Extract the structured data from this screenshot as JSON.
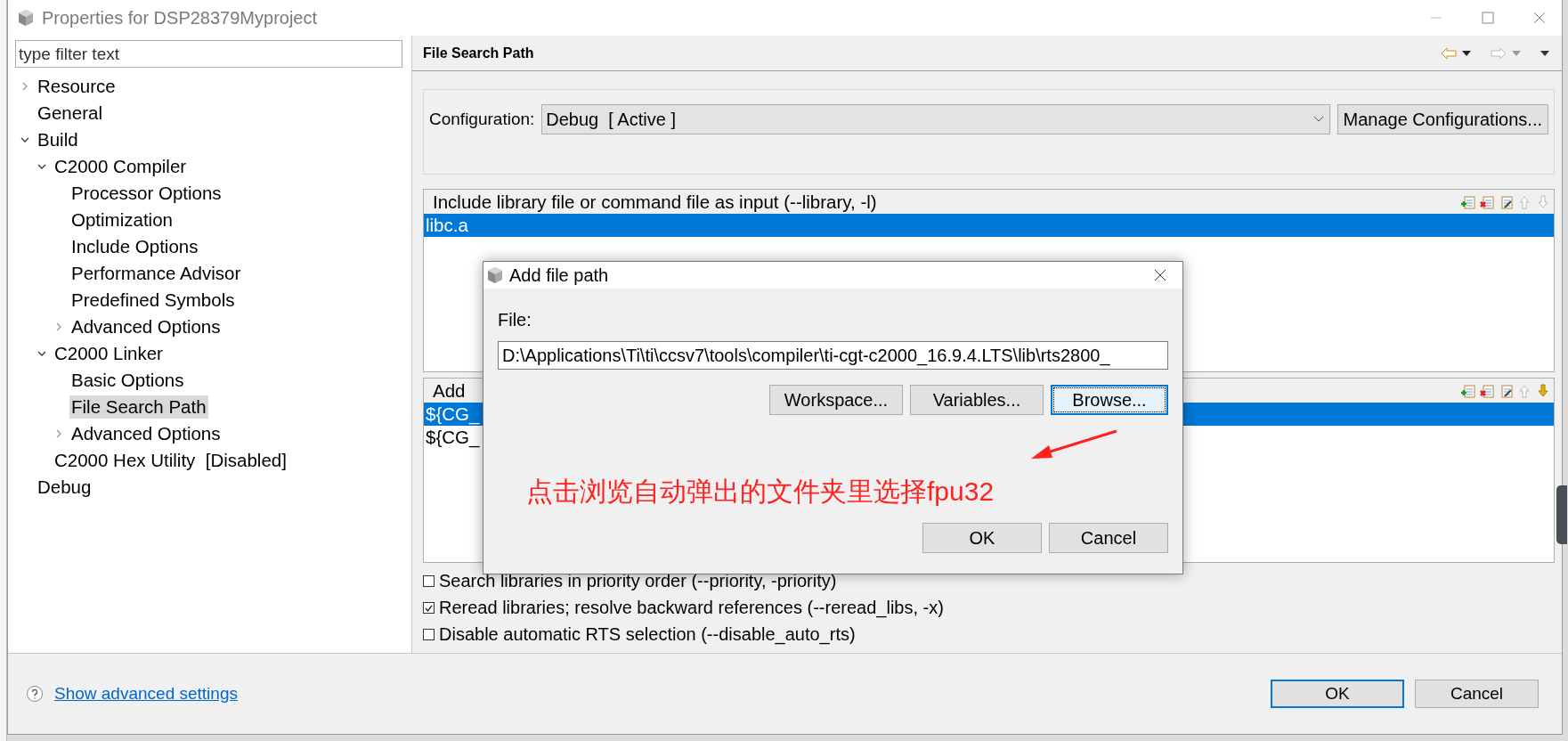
{
  "window": {
    "title": "Properties for DSP28379Myproject"
  },
  "filter": {
    "placeholder": "type filter text"
  },
  "tree": [
    {
      "label": "Resource",
      "expanded": false,
      "selected": false
    },
    {
      "label": "General",
      "selected": false
    },
    {
      "label": "Build",
      "expanded": true,
      "selected": false,
      "children": [
        {
          "label": "C2000 Compiler",
          "expanded": true,
          "selected": false,
          "children": [
            {
              "label": "Processor Options",
              "selected": false
            },
            {
              "label": "Optimization",
              "selected": false
            },
            {
              "label": "Include Options",
              "selected": false
            },
            {
              "label": "Performance Advisor",
              "selected": false
            },
            {
              "label": "Predefined Symbols",
              "selected": false
            },
            {
              "label": "Advanced Options",
              "expanded": false,
              "selected": false
            }
          ]
        },
        {
          "label": "C2000 Linker",
          "expanded": true,
          "selected": false,
          "children": [
            {
              "label": "Basic Options",
              "selected": false
            },
            {
              "label": "File Search Path",
              "selected": true
            },
            {
              "label": "Advanced Options",
              "expanded": false,
              "selected": false
            }
          ]
        },
        {
          "label": "C2000 Hex Utility  [Disabled]",
          "selected": false
        }
      ]
    },
    {
      "label": "Debug",
      "selected": false
    }
  ],
  "page": {
    "title": "File Search Path"
  },
  "configuration": {
    "label": "Configuration:",
    "value": "Debug  [ Active ]",
    "button": "Manage Configurations..."
  },
  "lists": [
    {
      "title": "Include library file or command file as input (--library, -l)",
      "tools": [
        {
          "kind": "add",
          "disabled": false
        },
        {
          "kind": "delete",
          "disabled": false
        },
        {
          "kind": "edit",
          "disabled": false
        },
        {
          "kind": "up",
          "disabled": true
        },
        {
          "kind": "down",
          "disabled": true
        }
      ],
      "items": [
        {
          "text": "libc.a",
          "selected": true
        }
      ]
    },
    {
      "title": "Add",
      "tools": [
        {
          "kind": "add",
          "disabled": false
        },
        {
          "kind": "delete",
          "disabled": false
        },
        {
          "kind": "edit",
          "disabled": false
        },
        {
          "kind": "up",
          "disabled": true
        },
        {
          "kind": "down",
          "disabled": false
        }
      ],
      "items": [
        {
          "text": "${CG_",
          "selected": true
        },
        {
          "text": "${CG_",
          "selected": false
        }
      ]
    }
  ],
  "options": [
    {
      "label": "Search libraries in priority order (--priority, -priority)",
      "checked": false
    },
    {
      "label": "Reread libraries; resolve backward references (--reread_libs, -x)",
      "checked": true
    },
    {
      "label": "Disable automatic RTS selection (--disable_auto_rts)",
      "checked": false
    }
  ],
  "dialog": {
    "title": "Add file path",
    "field_label": "File:",
    "value": "D:\\Applications\\Ti\\ti\\ccsv7\\tools\\compiler\\ti-cgt-c2000_16.9.4.LTS\\lib\\rts2800_",
    "buttons": [
      {
        "label": "Workspace...",
        "focused": false
      },
      {
        "label": "Variables...",
        "focused": false
      },
      {
        "label": "Browse...",
        "focused": true
      }
    ],
    "annotation": "点击浏览自动弹出的文件夹里选择fpu32",
    "footer_buttons": [
      {
        "label": "OK"
      },
      {
        "label": "Cancel"
      }
    ]
  },
  "footer": {
    "help_link": "Show advanced settings",
    "buttons": [
      {
        "label": "OK",
        "default": true
      },
      {
        "label": "Cancel",
        "default": false
      }
    ]
  }
}
